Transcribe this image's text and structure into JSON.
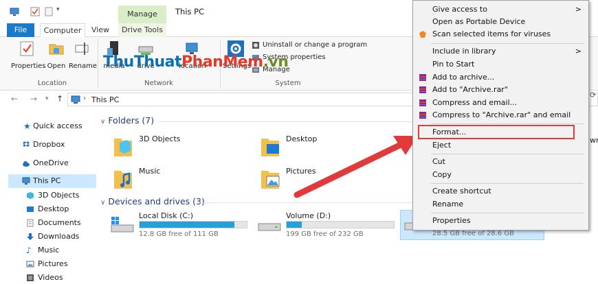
{
  "window": {
    "title": "This PC",
    "context_tab": "Manage"
  },
  "tabs": [
    {
      "label": "File"
    },
    {
      "label": "Computer"
    },
    {
      "label": "View"
    },
    {
      "label": "Drive Tools"
    }
  ],
  "ribbon": {
    "location": {
      "label": "Location",
      "buttons": [
        {
          "label": "Properties"
        },
        {
          "label": "Open"
        },
        {
          "label": "Rename"
        }
      ]
    },
    "network": {
      "label": "Network",
      "buttons": [
        {
          "label": "media"
        },
        {
          "label": "drive"
        },
        {
          "label": "location"
        }
      ]
    },
    "system": {
      "label": "System",
      "settings_label": "Settings",
      "rows": [
        {
          "label": "Uninstall or change a program"
        },
        {
          "label": "System properties"
        },
        {
          "label": "Manage"
        }
      ]
    }
  },
  "watermark": {
    "part1": "ThuThuat",
    "part2": "PhanMem",
    "part3": ".vn"
  },
  "address": {
    "path": "This PC"
  },
  "sidebar": {
    "items": [
      {
        "label": "Quick access"
      },
      {
        "label": "Dropbox"
      },
      {
        "label": "OneDrive"
      },
      {
        "label": "This PC"
      },
      {
        "label": "3D Objects"
      },
      {
        "label": "Desktop"
      },
      {
        "label": "Documents"
      },
      {
        "label": "Downloads"
      },
      {
        "label": "Music"
      },
      {
        "label": "Pictures"
      },
      {
        "label": "Videos"
      }
    ]
  },
  "folders": {
    "header": "Folders (7)",
    "items": [
      {
        "label": "3D Objects"
      },
      {
        "label": "Desktop"
      },
      {
        "label": "Music"
      },
      {
        "label": "Pictures"
      }
    ],
    "cut_label": "wn"
  },
  "drives": {
    "header": "Devices and drives (3)",
    "items": [
      {
        "name": "Local Disk (C:)",
        "free": "12.8 GB free of 111 GB",
        "used_fraction": 0.885
      },
      {
        "name": "Volume (D:)",
        "free": "199 GB free of 232 GB",
        "used_fraction": 0.14
      },
      {
        "name": "",
        "free": "28.5 GB free of 28.6 GB",
        "used_fraction": 0.004
      }
    ]
  },
  "context_menu": {
    "items": [
      {
        "label": "Give access to"
      },
      {
        "label": "Open as Portable Device"
      },
      {
        "label": "Scan selected items for viruses"
      },
      {
        "label": "Include in library"
      },
      {
        "label": "Pin to Start"
      },
      {
        "label": "Add to archive..."
      },
      {
        "label": "Add to \"Archive.rar\""
      },
      {
        "label": "Compress and email..."
      },
      {
        "label": "Compress to \"Archive.rar\" and email"
      },
      {
        "label": "Format..."
      },
      {
        "label": "Eject"
      },
      {
        "label": "Cut"
      },
      {
        "label": "Copy"
      },
      {
        "label": "Create shortcut"
      },
      {
        "label": "Rename"
      },
      {
        "label": "Properties"
      }
    ],
    "submenu_arrow": ">"
  },
  "colors": {
    "accent": "#1979ca",
    "folder": "#f3c04e",
    "progress": "#26a0da",
    "highlight": "#e33b3b",
    "selection": "#cce8ff"
  }
}
